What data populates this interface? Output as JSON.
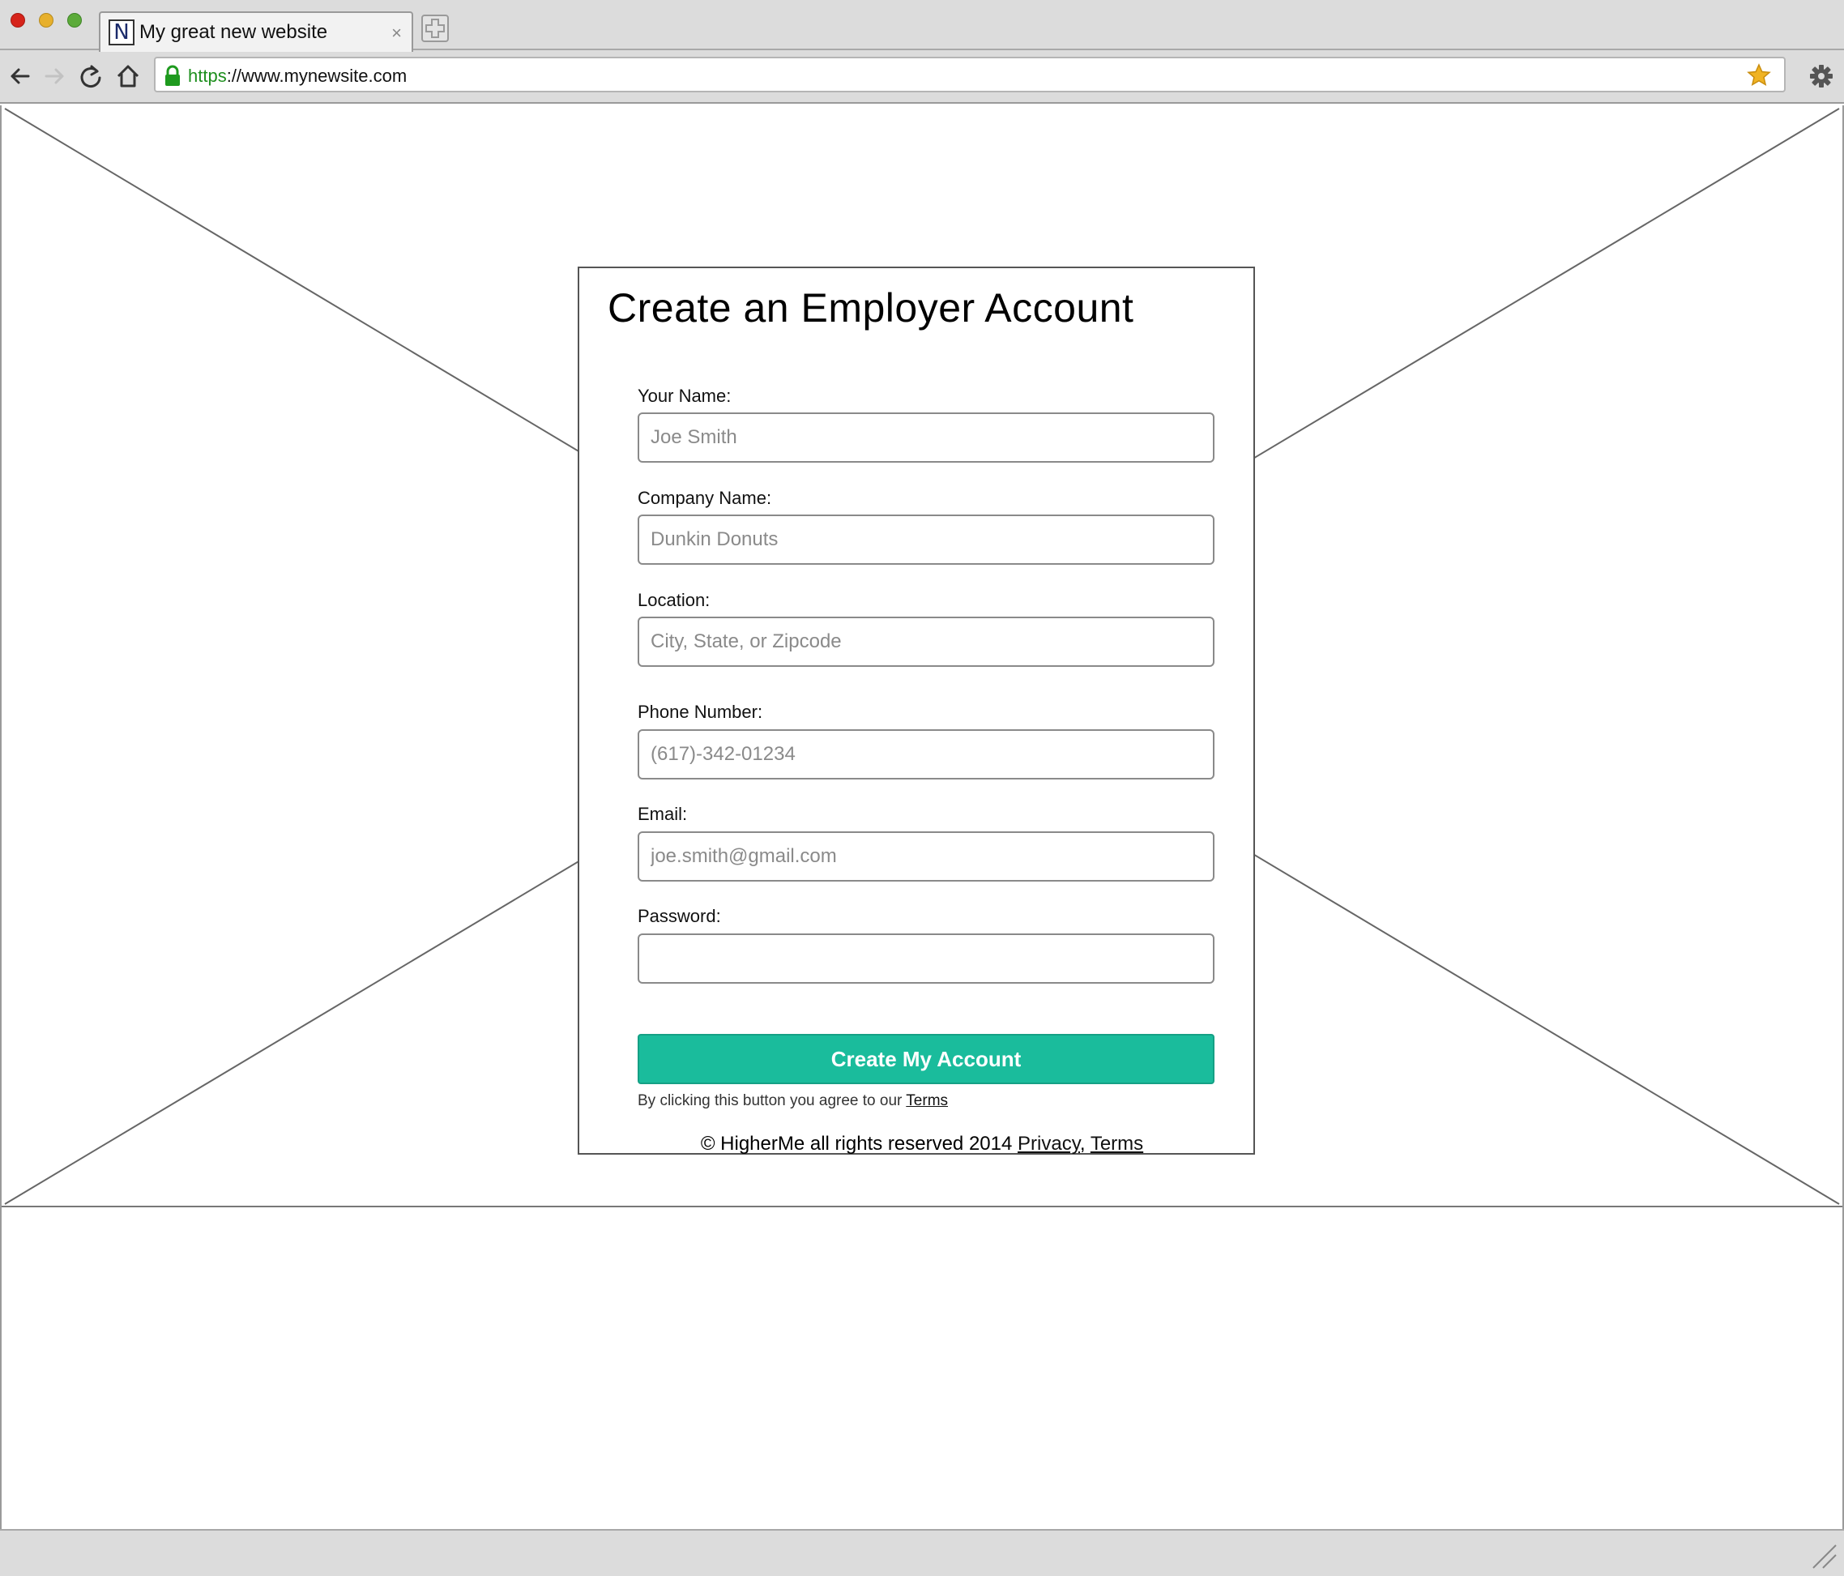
{
  "browser": {
    "tab_title": "My great new website",
    "tab_favicon": "N",
    "tab_close": "×",
    "url_scheme": "https",
    "url_rest": "://www.mynewsite.com"
  },
  "form": {
    "title": "Create an Employer Account",
    "fields": [
      {
        "label": "Your Name:",
        "placeholder": "Joe Smith",
        "value": ""
      },
      {
        "label": "Company Name:",
        "placeholder": "Dunkin Donuts",
        "value": ""
      },
      {
        "label": "Location:",
        "placeholder": "City, State, or Zipcode",
        "value": ""
      },
      {
        "label": "Phone Number:",
        "placeholder": "(617)-342-01234",
        "value": ""
      },
      {
        "label": "Email:",
        "placeholder": "joe.smith@gmail.com",
        "value": ""
      },
      {
        "label": "Password:",
        "placeholder": "",
        "value": ""
      }
    ],
    "submit_label": "Create My Account",
    "agree_prefix": "By clicking this button you agree to our",
    "agree_link": "Terms"
  },
  "footer": {
    "copyright": "© HigherMe all rights reserved 2014",
    "privacy_link": "Privacy",
    "separator": ",",
    "terms_link": "Terms"
  },
  "colors": {
    "accent": "#1abc9c",
    "url_scheme": "#1e8f1e",
    "lock": "#1e9a1e",
    "star": "#f0b323"
  },
  "icons": [
    "back-icon",
    "forward-icon",
    "reload-icon",
    "home-icon",
    "lock-icon",
    "star-icon",
    "gear-icon",
    "resize-grip-icon",
    "new-tab-icon"
  ]
}
